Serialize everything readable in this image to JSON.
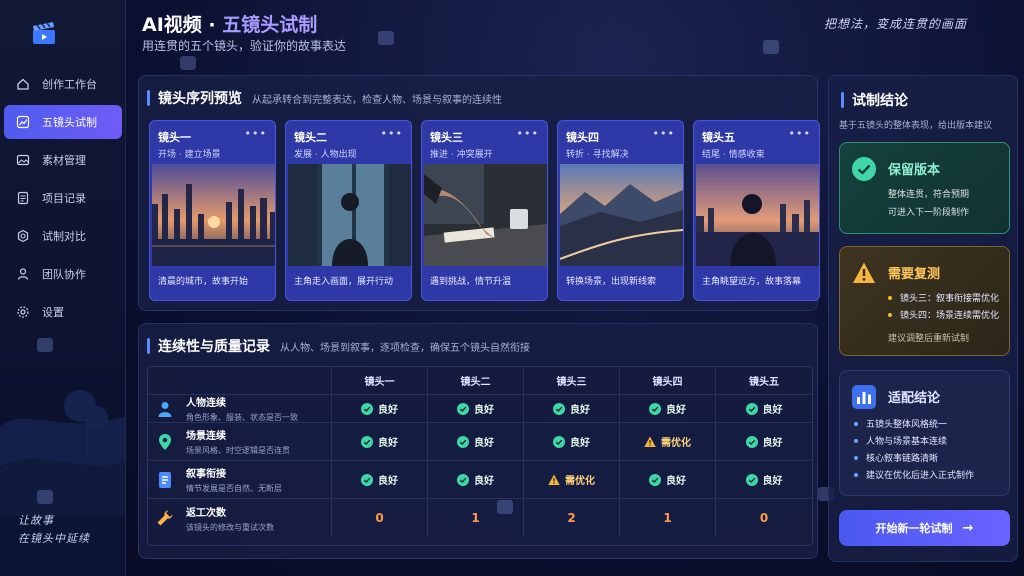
{
  "header": {
    "title_main": "AI视频 · ",
    "title_accent": "五镜头试制",
    "subtitle": "用连贯的五个镜头，验证你的故事表达",
    "slogan": "把想法，变成连贯的画面"
  },
  "sidebar": {
    "items": [
      {
        "label": "创作工作台",
        "icon": "home-icon"
      },
      {
        "label": "五镜头试制",
        "icon": "chart-icon",
        "active": true
      },
      {
        "label": "素材管理",
        "icon": "image-icon"
      },
      {
        "label": "项目记录",
        "icon": "document-icon"
      },
      {
        "label": "试制对比",
        "icon": "gear-icon"
      },
      {
        "label": "团队协作",
        "icon": "team-icon"
      },
      {
        "label": "设置",
        "icon": "settings-icon"
      }
    ],
    "slogan_line1": "让故事",
    "slogan_line2": "在镜头中延续"
  },
  "preview": {
    "title": "镜头序列预览",
    "desc": "从起承转合到完整表达，检查人物、场景与叙事的连续性",
    "shots": [
      {
        "name": "镜头一",
        "tag": "开场 · 建立场景",
        "caption": "清晨的城市，故事开始"
      },
      {
        "name": "镜头二",
        "tag": "发展 · 人物出现",
        "caption": "主角走入画面，展开行动"
      },
      {
        "name": "镜头三",
        "tag": "推进 · 冲突展开",
        "caption": "遇到挑战，情节升温"
      },
      {
        "name": "镜头四",
        "tag": "转折 · 寻找解决",
        "caption": "转换场景，出现新线索"
      },
      {
        "name": "镜头五",
        "tag": "结尾 · 情感收束",
        "caption": "主角眺望远方，故事落幕"
      }
    ],
    "more": "•••"
  },
  "quality": {
    "title": "连续性与质量记录",
    "desc": "从人物、场景到叙事，逐项检查，确保五个镜头自然衔接",
    "columns": [
      "镜头一",
      "镜头二",
      "镜头三",
      "镜头四",
      "镜头五"
    ],
    "rows": [
      {
        "title": "人物连续",
        "sub": "角色形象、服装、状态是否一致",
        "icon": "person-icon",
        "values": [
          "良好",
          "良好",
          "良好",
          "良好",
          "良好"
        ],
        "status": [
          "ok",
          "ok",
          "ok",
          "ok",
          "ok"
        ]
      },
      {
        "title": "场景连续",
        "sub": "场景风格、时空逻辑是否连贯",
        "icon": "location-icon",
        "values": [
          "良好",
          "良好",
          "良好",
          "需优化",
          "良好"
        ],
        "status": [
          "ok",
          "ok",
          "ok",
          "warn",
          "ok"
        ]
      },
      {
        "title": "叙事衔接",
        "sub": "情节发展是否自然、无断层",
        "icon": "document-icon",
        "values": [
          "良好",
          "良好",
          "需优化",
          "良好",
          "良好"
        ],
        "status": [
          "ok",
          "ok",
          "warn",
          "ok",
          "ok"
        ]
      },
      {
        "title": "返工次数",
        "sub": "该镜头的修改与重试次数",
        "icon": "wrench-icon",
        "values": [
          "0",
          "1",
          "2",
          "1",
          "0"
        ],
        "status": [
          "num",
          "num",
          "num",
          "num",
          "num"
        ]
      }
    ]
  },
  "conclusion": {
    "title": "试制结论",
    "desc": "基于五镜头的整体表现，给出版本建议",
    "keep": {
      "title": "保留版本",
      "line1": "整体连贯，符合预期",
      "line2": "可进入下一阶段制作"
    },
    "redo": {
      "title": "需要复测",
      "items": [
        "镜头三：叙事衔接需优化",
        "镜头四：场景连续需优化"
      ],
      "note": "建议调整后重新试制"
    },
    "fit": {
      "title": "适配结论",
      "items": [
        "五镜头整体风格统一",
        "人物与场景基本连续",
        "核心叙事链路清晰",
        "建议在优化后进入正式制作"
      ]
    },
    "button": "开始新一轮试制",
    "button_arrow": "→"
  },
  "colors": {
    "accent": "#5b8cff",
    "ok": "#3fd7a8",
    "warn": "#f5b63c",
    "num": "#ff9a4a"
  }
}
